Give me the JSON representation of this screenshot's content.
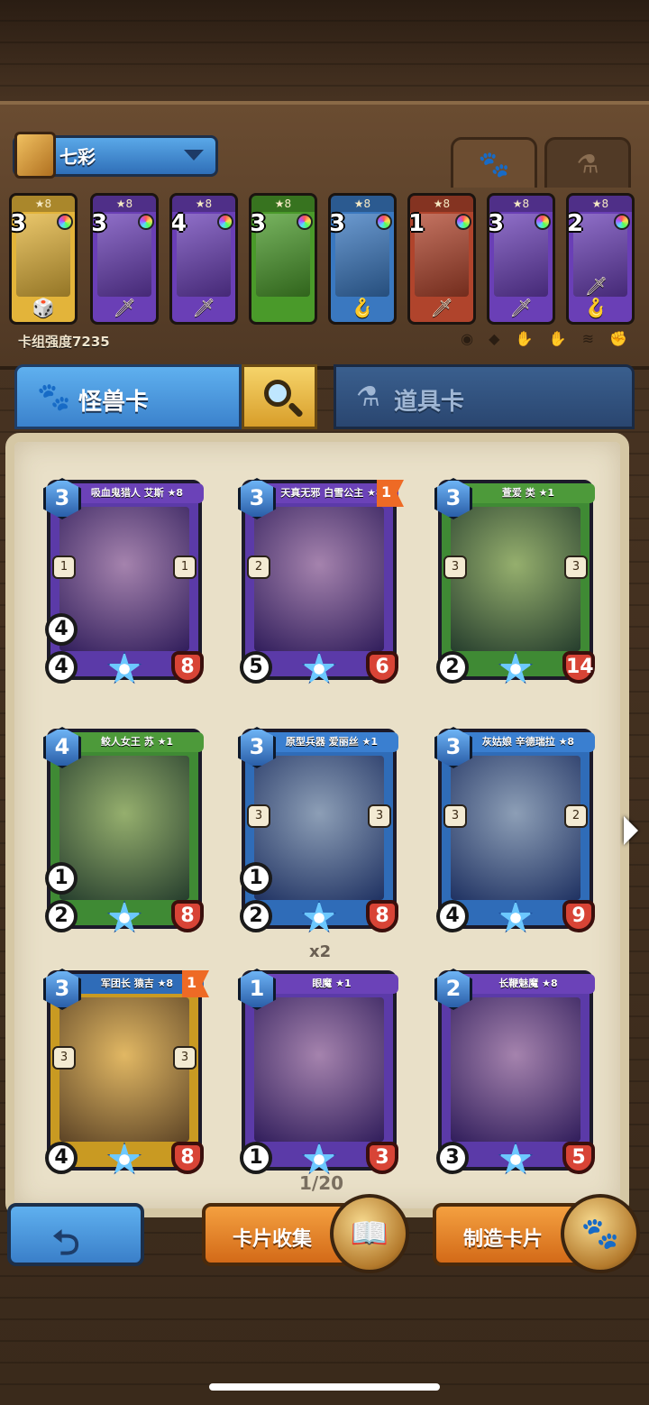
{
  "deck": {
    "name": "七彩",
    "power_label": "卡组强度7235",
    "filter_icons": [
      "radio-icon",
      "purple-icon",
      "hand-icon",
      "dark-icon",
      "gold-icon",
      "fire-icon"
    ],
    "mini_cards": [
      {
        "stars": "★8",
        "cost": "3",
        "type_icon": "🎲",
        "color": "#e3b43a"
      },
      {
        "stars": "★8",
        "cost": "3",
        "type_icon": "🗡",
        "color": "#6a3fb6"
      },
      {
        "stars": "★8",
        "cost": "4",
        "type_icon": "🗡",
        "color": "#6a3fb6"
      },
      {
        "stars": "★8",
        "cost": "3",
        "type_icon": "",
        "color": "#4a9a2a"
      },
      {
        "stars": "★8",
        "cost": "3",
        "type_icon": "🪝",
        "color": "#3a78c0"
      },
      {
        "stars": "★8",
        "cost": "1",
        "type_icon": "🗡",
        "color": "#b0442c"
      },
      {
        "stars": "★8",
        "cost": "3",
        "type_icon": "🗡",
        "color": "#6a3fb6"
      },
      {
        "stars": "★8",
        "cost": "2",
        "type_icon": "🗡🪝",
        "color": "#6a3fb6"
      }
    ]
  },
  "tabs": {
    "monster": "怪兽卡",
    "item": "道具卡"
  },
  "cards": [
    {
      "name": "吸血鬼猎人 艾斯 ★8",
      "cost": "3",
      "atk": "4",
      "dmg": "4",
      "hp": "8",
      "abil_l": "1",
      "abil_r": "1",
      "color": "#5b3aa8",
      "ribbon": "#6b42b8",
      "flag": ""
    },
    {
      "name": "天真无邪 白雪公主 ★8",
      "cost": "3",
      "atk": "5",
      "dmg": "",
      "hp": "6",
      "abil_l": "2",
      "abil_r": "",
      "color": "#5b3aa8",
      "ribbon": "#6b42b8",
      "flag": "1"
    },
    {
      "name": "萱爱 类 ★1",
      "cost": "3",
      "atk": "2",
      "dmg": "",
      "hp": "14",
      "abil_l": "3",
      "abil_r": "3",
      "color": "#3f8a34",
      "ribbon": "#4d9a3a",
      "flag": ""
    },
    {
      "name": "鲛人女王 苏 ★1",
      "cost": "4",
      "atk": "2",
      "dmg": "1",
      "hp": "8",
      "abil_l": "",
      "abil_r": "",
      "color": "#3f8a34",
      "ribbon": "#4d9a3a",
      "flag": ""
    },
    {
      "name": "原型兵器 爱丽丝 ★1",
      "cost": "3",
      "atk": "2",
      "dmg": "1",
      "hp": "8",
      "abil_l": "3",
      "abil_r": "3",
      "color": "#2f6cb8",
      "ribbon": "#3a7fd0",
      "flag": ""
    },
    {
      "name": "灰姑娘 辛德瑞拉 ★8",
      "cost": "3",
      "atk": "4",
      "dmg": "",
      "hp": "9",
      "abil_l": "3",
      "abil_r": "2",
      "color": "#2f6cb8",
      "ribbon": "#3a7fd0",
      "flag": ""
    },
    {
      "name": "军团长 猿吉 ★8",
      "cost": "3",
      "atk": "4",
      "dmg": "",
      "hp": "8",
      "abil_l": "3",
      "abil_r": "3",
      "color": "#c99a22",
      "ribbon": "#2f6cb8",
      "flag": "1"
    },
    {
      "name": "眼魔 ★1",
      "cost": "1",
      "atk": "1",
      "dmg": "",
      "hp": "3",
      "abil_l": "",
      "abil_r": "",
      "color": "#5b3aa8",
      "ribbon": "#6b42b8",
      "flag": ""
    },
    {
      "name": "长鞭魅魔 ★8",
      "cost": "2",
      "atk": "3",
      "dmg": "",
      "hp": "5",
      "abil_l": "",
      "abil_r": "",
      "color": "#5b3aa8",
      "ribbon": "#6b42b8",
      "flag": ""
    }
  ],
  "x2_label": "x2",
  "page_count": "1/20",
  "buttons": {
    "back": "back-arrow-icon",
    "collect": "卡片收集",
    "craft": "制造卡片"
  }
}
